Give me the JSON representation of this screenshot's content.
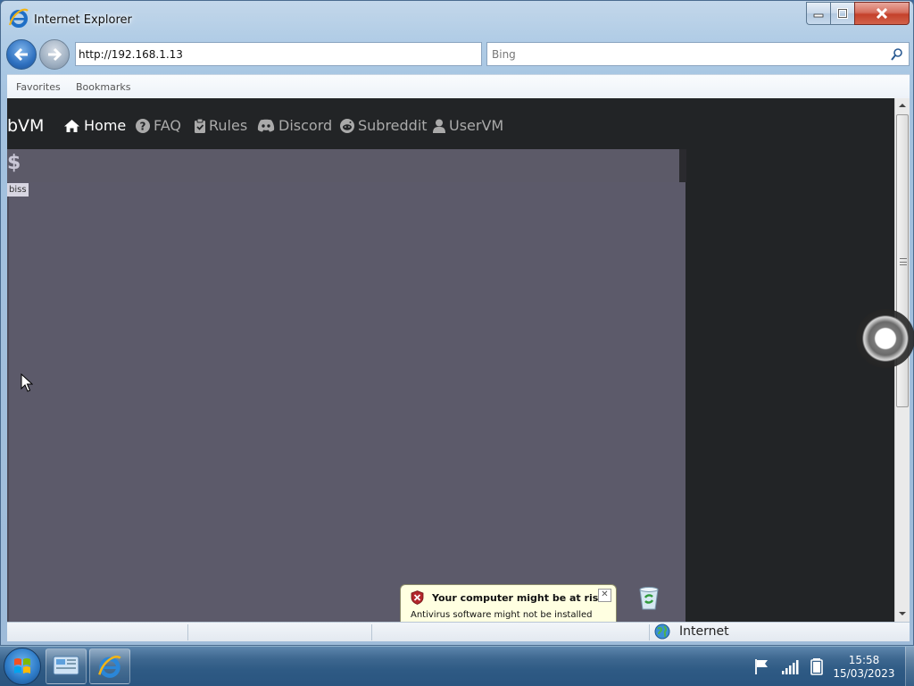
{
  "window": {
    "title": "Internet Explorer"
  },
  "navigation": {
    "address": "http://192.168.1.13",
    "search_placeholder": "Bing"
  },
  "favorites_bar": {
    "items": [
      "Favorites",
      "Bookmarks"
    ]
  },
  "site": {
    "brand": "bVM",
    "nav_links": [
      {
        "label": "Home",
        "icon": "home-icon",
        "active": true
      },
      {
        "label": "FAQ",
        "icon": "question-circle-icon"
      },
      {
        "label": "Rules",
        "icon": "clipboard-check-icon"
      },
      {
        "label": "Discord",
        "icon": "discord-icon"
      },
      {
        "label": "Subreddit",
        "icon": "reddit-icon"
      },
      {
        "label": "UserVM",
        "icon": "user-icon"
      }
    ],
    "vm_panel": {
      "glyph": "$",
      "label": "biss"
    }
  },
  "notification": {
    "title": "Your computer might be at risk",
    "body": "Antivirus software might not be installed",
    "close_glyph": "✕"
  },
  "status_bar": {
    "zone": "Internet"
  },
  "taskbar": {
    "clock_time": "15:58",
    "clock_date": "15/03/2023"
  }
}
